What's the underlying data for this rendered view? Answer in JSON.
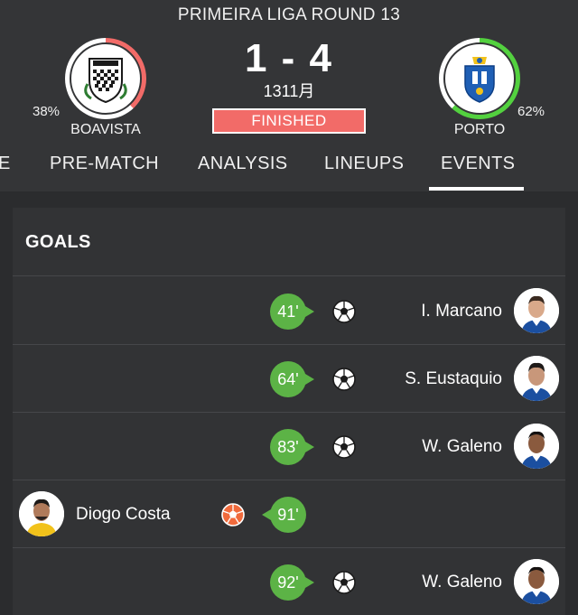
{
  "match": {
    "round_title": "PRIMEIRA LIGA ROUND 13",
    "score": "1 - 4",
    "date": "1311月",
    "status": "FINISHED"
  },
  "home": {
    "name": "BOAVISTA",
    "possession_pct": "38%",
    "possession_value": 38,
    "ring_color": "#f26b68"
  },
  "away": {
    "name": "PORTO",
    "possession_pct": "62%",
    "possession_value": 62,
    "ring_color": "#53d13f"
  },
  "tabs": [
    {
      "label": "E"
    },
    {
      "label": "PRE-MATCH"
    },
    {
      "label": "ANALYSIS"
    },
    {
      "label": "LINEUPS"
    },
    {
      "label": "EVENTS",
      "active": true
    }
  ],
  "goals": {
    "title": "GOALS",
    "events": [
      {
        "minute": "41'",
        "player": "I. Marcano",
        "side": "away",
        "type": "goal"
      },
      {
        "minute": "64'",
        "player": "S. Eustaquio",
        "side": "away",
        "type": "goal"
      },
      {
        "minute": "83'",
        "player": "W. Galeno",
        "side": "away",
        "type": "goal"
      },
      {
        "minute": "91'",
        "player": "Diogo Costa",
        "side": "home",
        "type": "own-goal"
      },
      {
        "minute": "92'",
        "player": "W. Galeno",
        "side": "away",
        "type": "goal"
      }
    ]
  },
  "colors": {
    "accent_red": "#f26b68",
    "minute_green": "#5cb346",
    "own_goal_orange": "#f06a3c",
    "background": "#2b2c2e"
  },
  "icons": [
    "soccer-ball-icon",
    "own-goal-ball-icon",
    "boavista-crest-icon",
    "porto-crest-icon",
    "player-avatar-icon"
  ]
}
